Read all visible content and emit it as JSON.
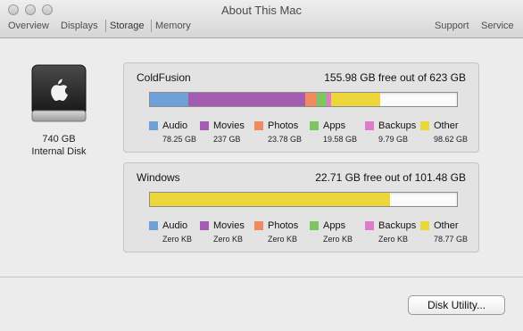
{
  "window": {
    "title": "About This Mac"
  },
  "tabs": {
    "overview": "Overview",
    "displays": "Displays",
    "storage": "Storage",
    "memory": "Memory",
    "support": "Support",
    "service": "Service"
  },
  "disk": {
    "size": "740 GB",
    "type": "Internal Disk",
    "icon": "apple-logo-icon"
  },
  "colors": {
    "audio": "#6fa0d8",
    "movies": "#a25cb0",
    "photos": "#f08a5f",
    "apps": "#7dc763",
    "backups": "#df7bcb",
    "other": "#ecd63a"
  },
  "volumes": [
    {
      "name": "ColdFusion",
      "free_text": "155.98 GB free out of 623 GB",
      "used_fraction": 0.75,
      "legend": [
        {
          "label": "Audio",
          "value": "78.25 GB"
        },
        {
          "label": "Movies",
          "value": "237 GB"
        },
        {
          "label": "Photos",
          "value": "23.78 GB"
        },
        {
          "label": "Apps",
          "value": "19.58 GB"
        },
        {
          "label": "Backups",
          "value": "9.79 GB"
        },
        {
          "label": "Other",
          "value": "98.62 GB"
        }
      ]
    },
    {
      "name": "Windows",
      "free_text": "22.71 GB free out of 101.48 GB",
      "used_fraction": 0.78,
      "legend": [
        {
          "label": "Audio",
          "value": "Zero KB"
        },
        {
          "label": "Movies",
          "value": "Zero KB"
        },
        {
          "label": "Photos",
          "value": "Zero KB"
        },
        {
          "label": "Apps",
          "value": "Zero KB"
        },
        {
          "label": "Backups",
          "value": "Zero KB"
        },
        {
          "label": "Other",
          "value": "78.77 GB"
        }
      ]
    }
  ],
  "footer": {
    "disk_utility": "Disk Utility..."
  }
}
